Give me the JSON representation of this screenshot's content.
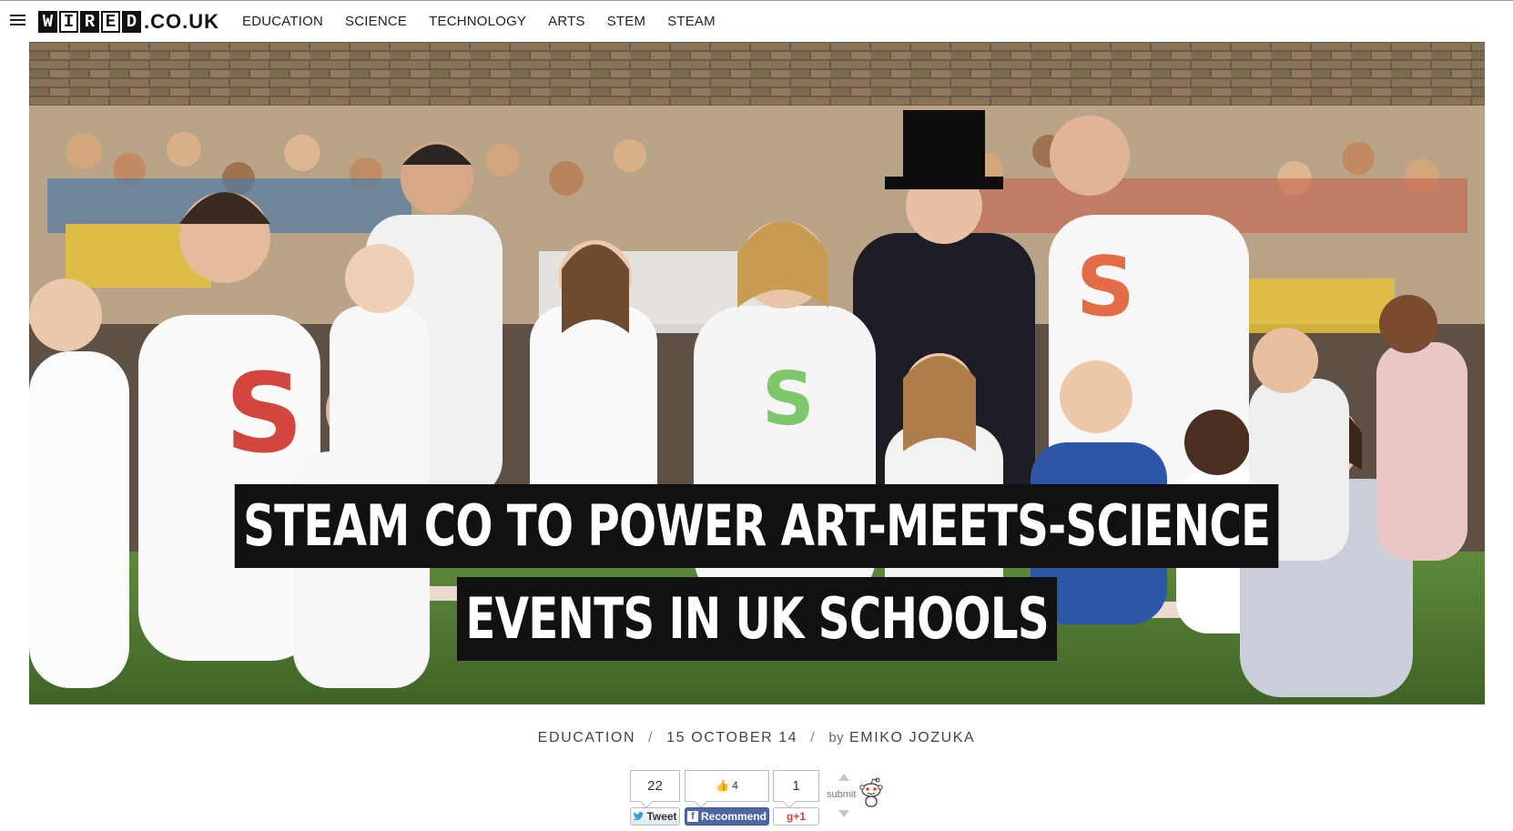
{
  "header": {
    "logo_letters": [
      "W",
      "I",
      "R",
      "E",
      "D"
    ],
    "logo_suffix": ".CO.UK",
    "nav": [
      "EDUCATION",
      "SCIENCE",
      "TECHNOLOGY",
      "ARTS",
      "STEM",
      "STEAM"
    ]
  },
  "hero": {
    "headline_line1": "STEAM CO TO POWER ART-MEETS-SCIENCE",
    "headline_line2": "EVENTS IN UK SCHOOLS"
  },
  "meta": {
    "category": "EDUCATION",
    "date": "15 OCTOBER 14",
    "by": "by",
    "author": "EMIKO JOZUKA"
  },
  "social": {
    "tweet_count": "22",
    "like_count": "4",
    "gplus_count": "1",
    "tweet_label": "Tweet",
    "recommend_label": "Recommend",
    "gplus_label": "g+1",
    "reddit_label": "submit"
  },
  "colors": {
    "headline_bg": "#111111",
    "facebook": "#4c67a1",
    "gplus": "#d23f31",
    "twitter": "#2d9ee0"
  },
  "icons": [
    "menu-icon",
    "twitter-bird-icon",
    "facebook-f-icon",
    "thumbs-up-icon",
    "reddit-alien-icon",
    "upvote-arrow-icon",
    "downvote-arrow-icon"
  ]
}
